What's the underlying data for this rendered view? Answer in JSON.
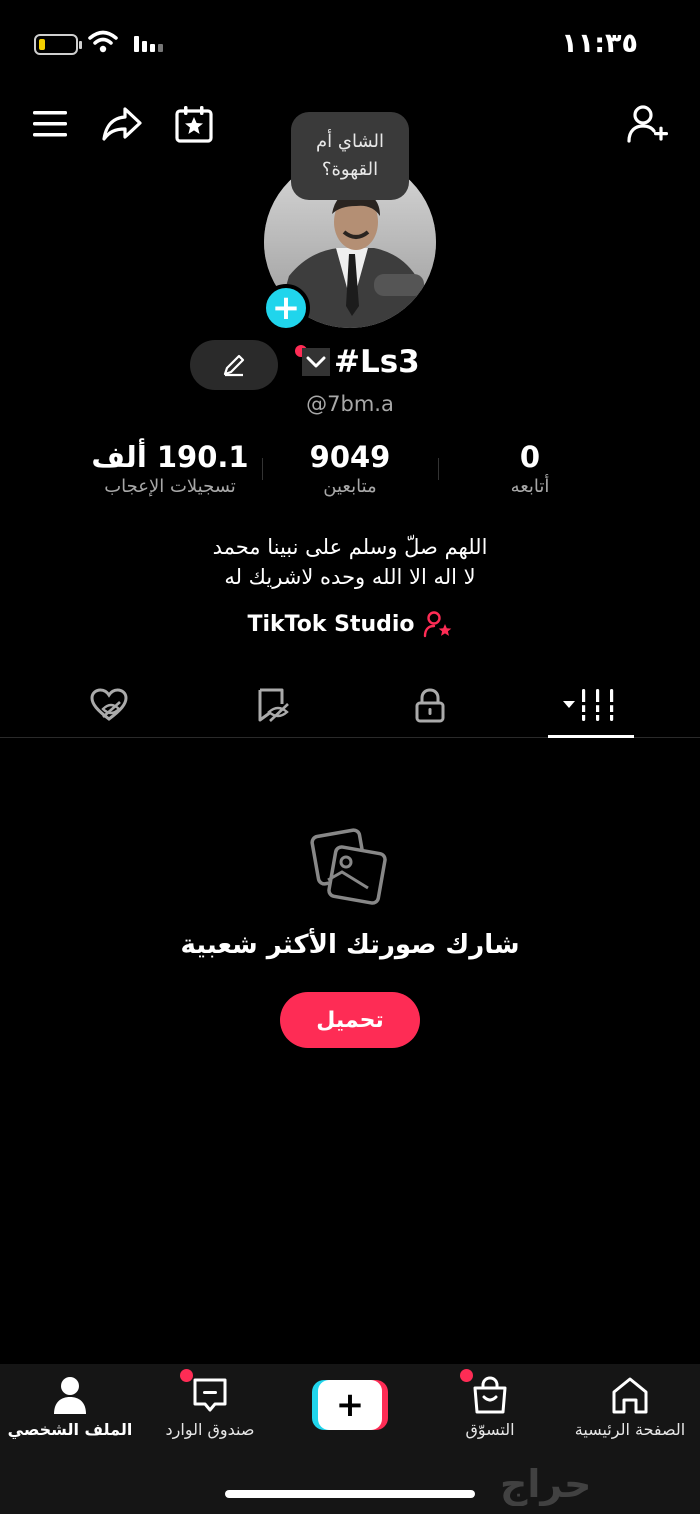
{
  "status_bar": {
    "time": "١١:٣٥"
  },
  "header": {
    "menu_icon": "menu-icon",
    "share_icon": "share-icon",
    "calendar_icon": "calendar-star-icon",
    "add_friend_icon": "add-friend-icon"
  },
  "profile": {
    "note": [
      "الشاي أم",
      "القهوة؟"
    ],
    "display_name": "#Ls3",
    "username": "@7bm.a",
    "stats": [
      {
        "value": "190.1 ألف",
        "label": "تسجيلات الإعجاب"
      },
      {
        "value": "9049",
        "label": "متابعين"
      },
      {
        "value": "0",
        "label": "أتابعه"
      }
    ],
    "bio": [
      "اللهم صلّ وسلم على نبينا محمد",
      "لا اله الا الله وحده لاشريك له"
    ],
    "studio_label": "TikTok Studio"
  },
  "tabs": [
    "liked-hidden-icon",
    "favorites-hidden-icon",
    "private-lock-icon",
    "videos-grid-icon"
  ],
  "empty_state": {
    "title": "شارك صورتك الأكثر شعبية",
    "button": "تحميل"
  },
  "bottom_nav": {
    "profile": "الملف الشخصي",
    "inbox": "صندوق الوارد",
    "shop": "التسوّق",
    "home": "الصفحة الرئيسية"
  },
  "watermark": "حراج",
  "colors": {
    "accent": "#fe2c55",
    "cyan": "#20d5ec",
    "background": "#000000"
  }
}
